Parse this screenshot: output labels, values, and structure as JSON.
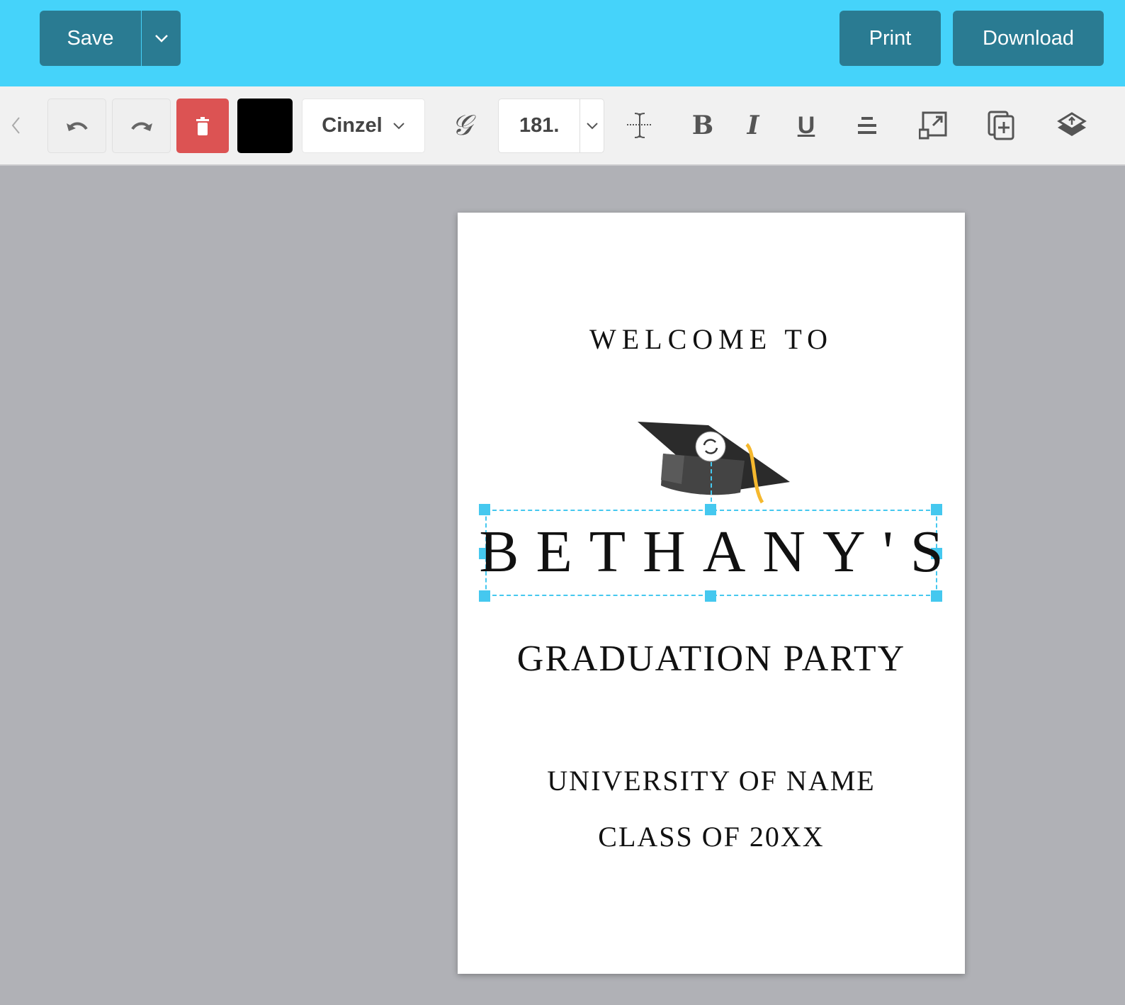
{
  "topbar": {
    "save": "Save",
    "print": "Print",
    "download": "Download"
  },
  "toolbar": {
    "font": "Cinzel",
    "font_size": "181.",
    "color_swatch": "#000000",
    "delete_color": "#dc5353"
  },
  "card": {
    "line1": "WELCOME TO",
    "name": "BETHANY'S",
    "line2": "GRADUATION PARTY",
    "line3": "UNIVERSITY OF NAME",
    "line4": "CLASS OF 20XX"
  },
  "colors": {
    "accent": "#45d3fa",
    "button": "#2a7b92",
    "selection": "#45c8ef"
  }
}
